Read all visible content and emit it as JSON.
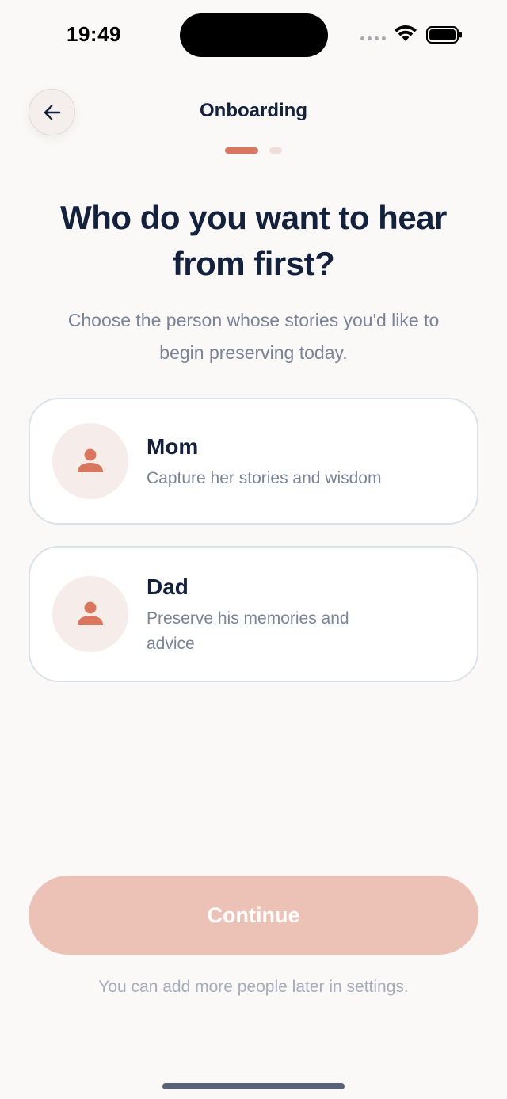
{
  "status_bar": {
    "time": "19:49"
  },
  "header": {
    "title": "Onboarding"
  },
  "progress": {
    "current_step": 1,
    "total_steps": 2
  },
  "main": {
    "heading": "Who do you want to hear from first?",
    "subtext": "Choose the person whose stories you'd like to begin preserving today."
  },
  "options": [
    {
      "title": "Mom",
      "description": "Capture her stories and wisdom",
      "icon": "person-icon"
    },
    {
      "title": "Dad",
      "description": "Preserve his memories and advice",
      "icon": "person-icon"
    }
  ],
  "footer": {
    "continue_label": "Continue",
    "note": "You can add more people later in settings."
  },
  "colors": {
    "accent": "#D9775E",
    "button_disabled": "#ECC2B6",
    "background": "#FBF9F8",
    "text_primary": "#14213D",
    "text_secondary": "#7A8397"
  }
}
